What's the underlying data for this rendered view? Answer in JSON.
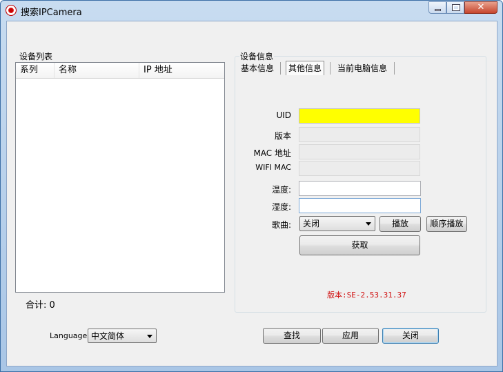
{
  "window": {
    "title": "搜索IPCamera",
    "close_glyph": "✕"
  },
  "device_list": {
    "group_label": "设备列表",
    "columns": [
      "系列",
      "名称",
      "IP 地址"
    ],
    "rows": [],
    "total_label": "合计: 0"
  },
  "device_info": {
    "group_label": "设备信息",
    "tabs": [
      {
        "label": "基本信息",
        "active": false
      },
      {
        "label": "其他信息",
        "active": true
      },
      {
        "label": "当前电脑信息",
        "active": false
      }
    ],
    "fields": {
      "uid_label": "UID",
      "uid_value": "",
      "version_label": "版本",
      "version_value": "",
      "mac_label": "MAC 地址",
      "mac_value": "",
      "wifi_mac_label": "WIFI MAC",
      "wifi_mac_value": "",
      "temperature_label": "温度:",
      "temperature_value": "",
      "humidity_label": "湿度:",
      "humidity_value": "",
      "song_label": "歌曲:",
      "song_selected": "关闭"
    },
    "buttons": {
      "play": "播放",
      "sequential_play": "顺序播放",
      "fetch": "获取"
    },
    "version_text": "版本:SE-2.53.31.37"
  },
  "footer": {
    "language_label": "Language",
    "language_selected": "中文简体",
    "search_button": "查找",
    "apply_button": "应用",
    "close_button": "关闭"
  },
  "colors": {
    "uid_highlight": "#ffff00",
    "version_text": "#d01010"
  }
}
